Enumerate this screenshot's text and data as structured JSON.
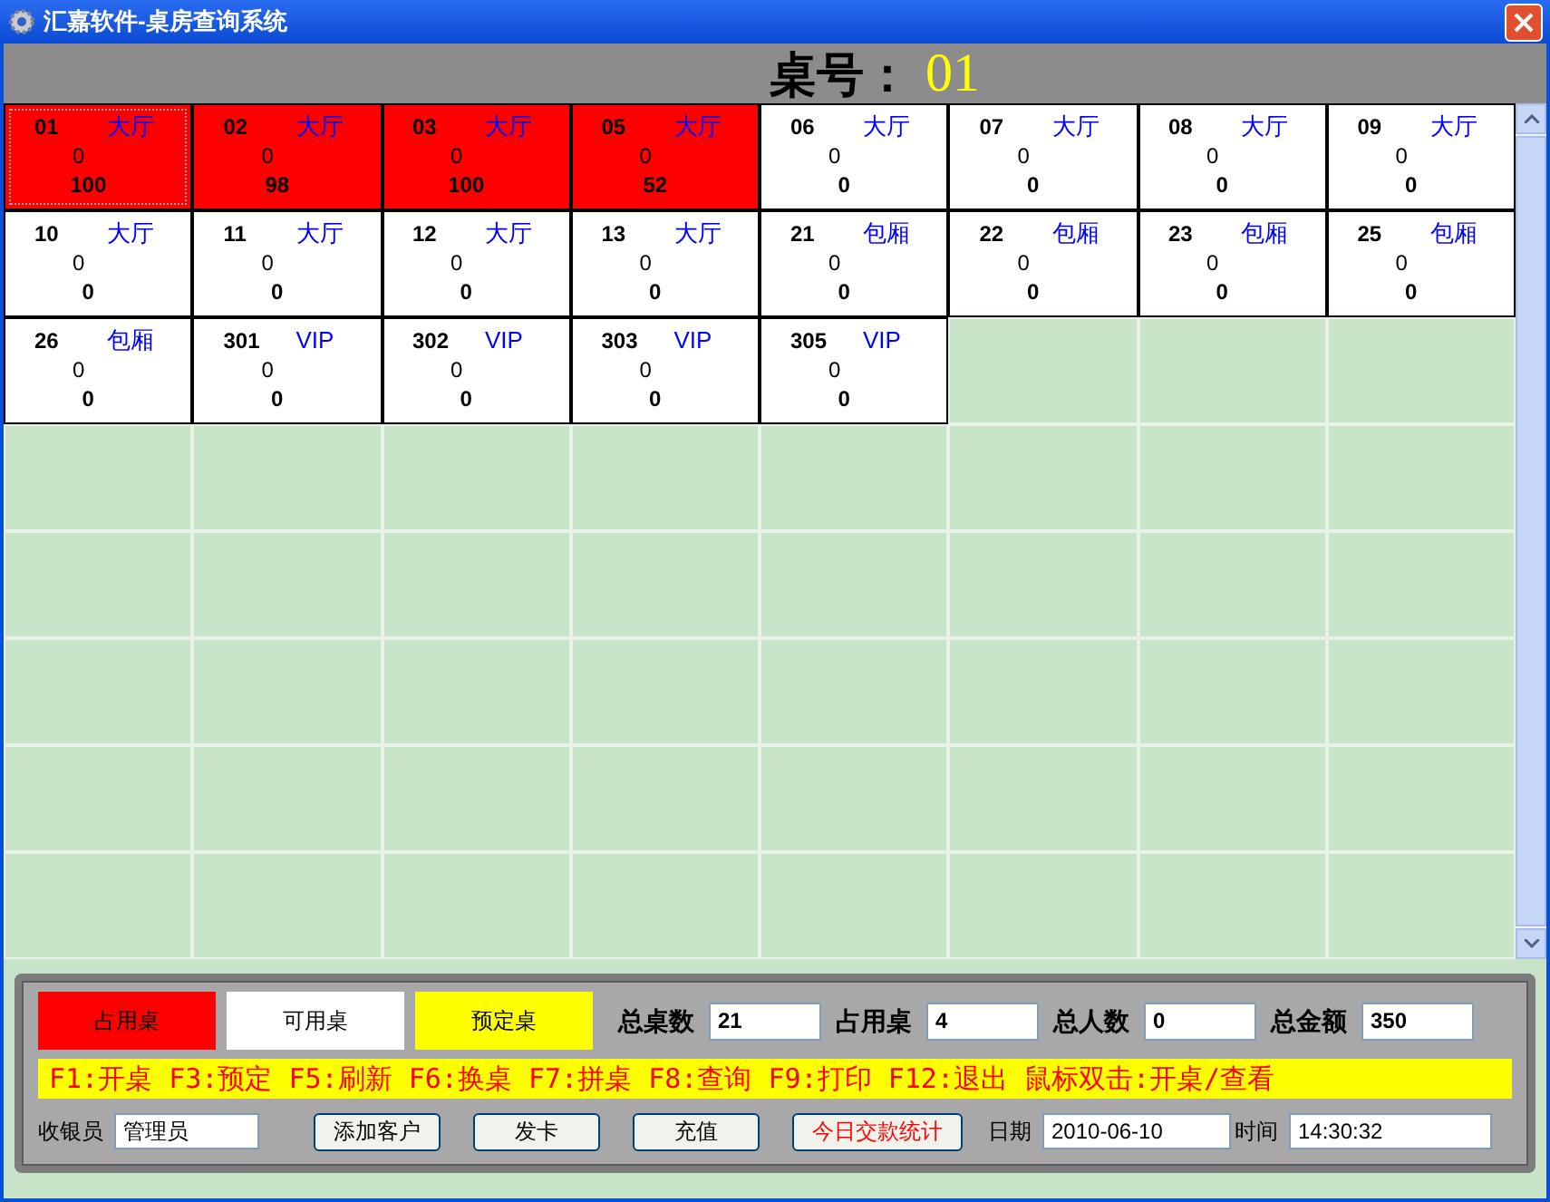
{
  "window": {
    "title": "汇嘉软件-桌房查询系统"
  },
  "header": {
    "label": "桌号：",
    "table_no": "01"
  },
  "tables": [
    {
      "number": "01",
      "area": "大厅",
      "guests": "0",
      "amount": "100",
      "occupied": true,
      "selected": true
    },
    {
      "number": "02",
      "area": "大厅",
      "guests": "0",
      "amount": "98",
      "occupied": true,
      "selected": false
    },
    {
      "number": "03",
      "area": "大厅",
      "guests": "0",
      "amount": "100",
      "occupied": true,
      "selected": false
    },
    {
      "number": "05",
      "area": "大厅",
      "guests": "0",
      "amount": "52",
      "occupied": true,
      "selected": false
    },
    {
      "number": "06",
      "area": "大厅",
      "guests": "0",
      "amount": "0",
      "occupied": false,
      "selected": false
    },
    {
      "number": "07",
      "area": "大厅",
      "guests": "0",
      "amount": "0",
      "occupied": false,
      "selected": false
    },
    {
      "number": "08",
      "area": "大厅",
      "guests": "0",
      "amount": "0",
      "occupied": false,
      "selected": false
    },
    {
      "number": "09",
      "area": "大厅",
      "guests": "0",
      "amount": "0",
      "occupied": false,
      "selected": false
    },
    {
      "number": "10",
      "area": "大厅",
      "guests": "0",
      "amount": "0",
      "occupied": false,
      "selected": false
    },
    {
      "number": "11",
      "area": "大厅",
      "guests": "0",
      "amount": "0",
      "occupied": false,
      "selected": false
    },
    {
      "number": "12",
      "area": "大厅",
      "guests": "0",
      "amount": "0",
      "occupied": false,
      "selected": false
    },
    {
      "number": "13",
      "area": "大厅",
      "guests": "0",
      "amount": "0",
      "occupied": false,
      "selected": false
    },
    {
      "number": "21",
      "area": "包厢",
      "guests": "0",
      "amount": "0",
      "occupied": false,
      "selected": false
    },
    {
      "number": "22",
      "area": "包厢",
      "guests": "0",
      "amount": "0",
      "occupied": false,
      "selected": false
    },
    {
      "number": "23",
      "area": "包厢",
      "guests": "0",
      "amount": "0",
      "occupied": false,
      "selected": false
    },
    {
      "number": "25",
      "area": "包厢",
      "guests": "0",
      "amount": "0",
      "occupied": false,
      "selected": false
    },
    {
      "number": "26",
      "area": "包厢",
      "guests": "0",
      "amount": "0",
      "occupied": false,
      "selected": false
    },
    {
      "number": "301",
      "area": "VIP",
      "guests": "0",
      "amount": "0",
      "occupied": false,
      "selected": false
    },
    {
      "number": "302",
      "area": "VIP",
      "guests": "0",
      "amount": "0",
      "occupied": false,
      "selected": false
    },
    {
      "number": "303",
      "area": "VIP",
      "guests": "0",
      "amount": "0",
      "occupied": false,
      "selected": false
    },
    {
      "number": "305",
      "area": "VIP",
      "guests": "0",
      "amount": "0",
      "occupied": false,
      "selected": false
    }
  ],
  "legend": [
    {
      "label": "占用桌",
      "color": "#ff0000"
    },
    {
      "label": "可用桌",
      "color": "#ffffff"
    },
    {
      "label": "预定桌",
      "color": "#ffff00"
    }
  ],
  "stats": [
    {
      "label": "总桌数",
      "value": "21"
    },
    {
      "label": "占用桌",
      "value": "4"
    },
    {
      "label": "总人数",
      "value": "0"
    },
    {
      "label": "总金额",
      "value": "350"
    }
  ],
  "shortcuts": "F1:开桌 F3:预定 F5:刷新 F6:换桌 F7:拼桌 F8:查询 F9:打印  F12:退出  鼠标双击:开桌/查看",
  "cashier": {
    "label": "收银员",
    "value": "管理员"
  },
  "buttons": [
    {
      "label": "添加客户",
      "kind": "normal"
    },
    {
      "label": "发卡",
      "kind": "normal"
    },
    {
      "label": "充值",
      "kind": "normal"
    },
    {
      "label": "今日交款统计",
      "kind": "highlight"
    }
  ],
  "date": {
    "label": "日期",
    "value": "2010-06-10"
  },
  "time": {
    "label": "时间",
    "value": "14:30:32"
  }
}
